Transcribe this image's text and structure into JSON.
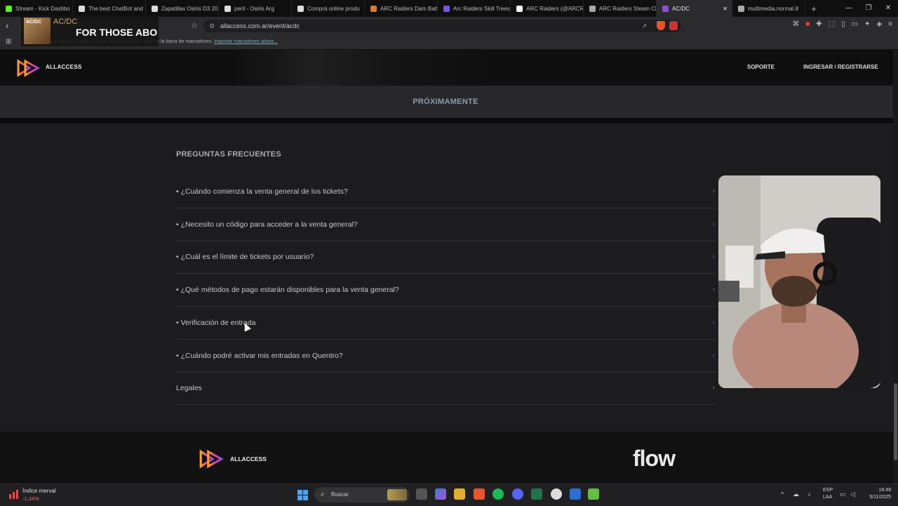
{
  "browser": {
    "tabs": [
      {
        "label": "Stream - Kick Dashbo",
        "color": "#53fc18"
      },
      {
        "label": "The best ChatBot and",
        "color": "#dddddd"
      },
      {
        "label": "Zapatillas Osiris D3 20",
        "color": "#dddddd"
      },
      {
        "label": "peril - Osiris Arg",
        "color": "#dddddd"
      },
      {
        "label": "Comprá online produ",
        "color": "#dddddd"
      },
      {
        "label": "ARC Raiders Dam Batt",
        "color": "#e07a2c"
      },
      {
        "label": "Arc Raiders Skill Trees",
        "color": "#7a55e0"
      },
      {
        "label": "ARC Raiders (@ARCRa",
        "color": "#ffffff"
      },
      {
        "label": "ARC Raiders Steam Ch",
        "color": "#aaaaaa"
      },
      {
        "label": "AC/DC",
        "color": "#8a4fd8",
        "active": true
      },
      {
        "label": "multimedia.normal.8",
        "color": "#aaaaaa"
      }
    ],
    "url": "allaccess.com.ar/event/acdc",
    "bookmarks_hint": "un acceso rápido, coloca tus marcadores aquí en la barra de marcadores.",
    "bookmarks_link": "Importar marcadores ahora..."
  },
  "now_playing": {
    "artist": "AC/DC",
    "song": "FOR THOSE ABO",
    "cover_text": "AC/DC"
  },
  "site": {
    "logo_text": "ALLACCESS",
    "nav": {
      "support": "SOPORTE",
      "login": "INGRESAR / REGISTRARSE"
    },
    "coming_soon": "PRÓXIMAMENTE",
    "faq_title": "PREGUNTAS FRECUENTES",
    "faq": [
      "• ¿Cuándo comienza la venta general de los tickets?",
      "• ¿Necesito un código para acceder a la venta general?",
      "• ¿Cuál es el límite de tickets por usuario?",
      "• ¿Qué métodos de pago estarán disponibles para la venta general?",
      "• Verificación de entrada",
      "• ¿Cuándo podré activar mis entradas en Quentro?",
      "Legales"
    ],
    "footer_logo_text": "ALLACCESS",
    "partner": "flow",
    "accent": "#8a4fd8"
  },
  "taskbar": {
    "stock_name": "Índice merval",
    "stock_change": "-1,34%",
    "search_placeholder": "Buscar",
    "lang_top": "ESP",
    "lang_bottom": "LAA",
    "time": "16:49",
    "date": "5/11/2025"
  }
}
